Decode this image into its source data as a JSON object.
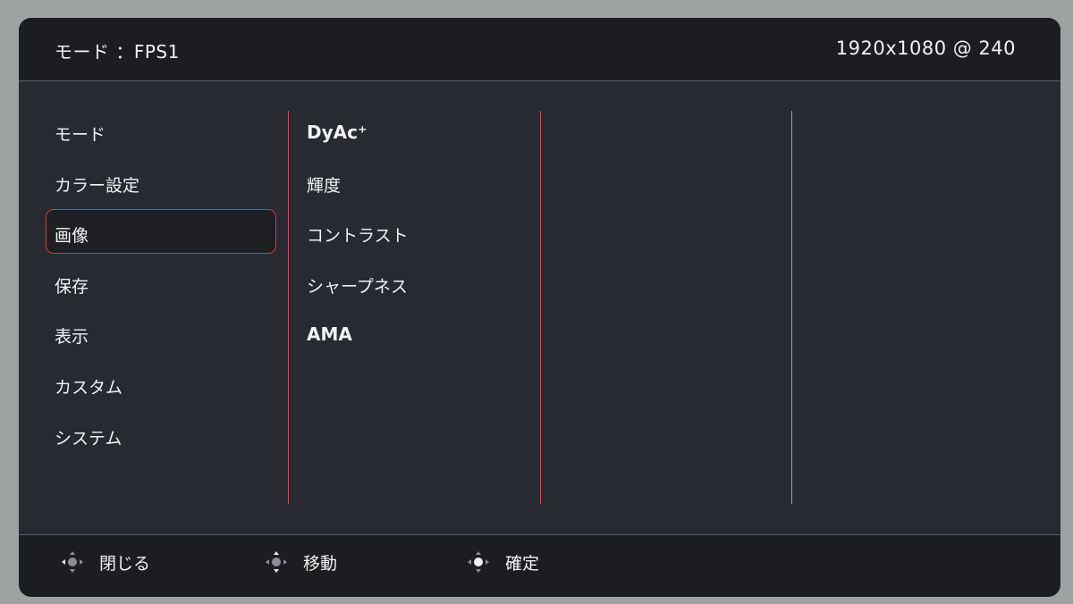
{
  "header": {
    "mode_label": "モード ：FPS1",
    "resolution": "1920x1080 @ 240"
  },
  "menu": {
    "items": [
      {
        "label": "モード"
      },
      {
        "label": "カラー設定"
      },
      {
        "label": "画像"
      },
      {
        "label": "保存"
      },
      {
        "label": "表示"
      },
      {
        "label": "カスタム"
      },
      {
        "label": "システム"
      }
    ],
    "selected_index": 2
  },
  "submenu": {
    "items": [
      {
        "label": "DyAc⁺"
      },
      {
        "label": "輝度"
      },
      {
        "label": "コントラスト"
      },
      {
        "label": "シャープネス"
      },
      {
        "label": "AMA"
      }
    ]
  },
  "footer": {
    "close_label": "閉じる",
    "move_label": "移動",
    "confirm_label": "確定",
    "close_icon": "joystick-left-icon",
    "move_icon": "joystick-updown-icon",
    "confirm_icon": "joystick-press-icon"
  },
  "colors": {
    "selection_border": "#d63a3a",
    "panel_bg": "#272a31"
  }
}
